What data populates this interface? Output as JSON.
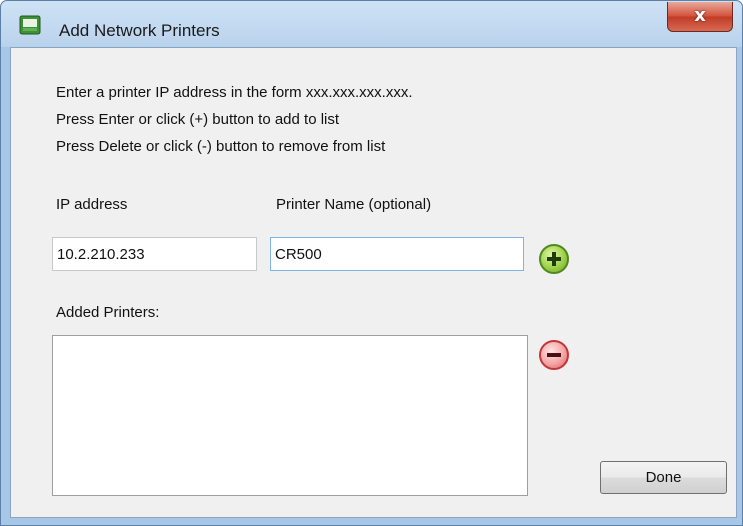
{
  "window": {
    "title": "Add Network Printers",
    "close_glyph": "x"
  },
  "instructions": [
    "Enter a printer IP address in the form xxx.xxx.xxx.xxx.",
    "Press Enter or click (+) button to add to list",
    "Press Delete or click (-) button to remove from list"
  ],
  "form": {
    "ip_label": "IP address",
    "ip_value": "10.2.210.233",
    "name_label": "Printer Name (optional)",
    "name_value": "CR500"
  },
  "list": {
    "label": "Added Printers:",
    "items": []
  },
  "buttons": {
    "add_icon": "plus-icon",
    "remove_icon": "minus-icon",
    "done_label": "Done"
  },
  "colors": {
    "client_bg": "#f0f0f0",
    "titlebar": "#b9d2ec",
    "close_red": "#c13b25",
    "add_green": "#8bc34a",
    "remove_red": "#d95d5d"
  }
}
